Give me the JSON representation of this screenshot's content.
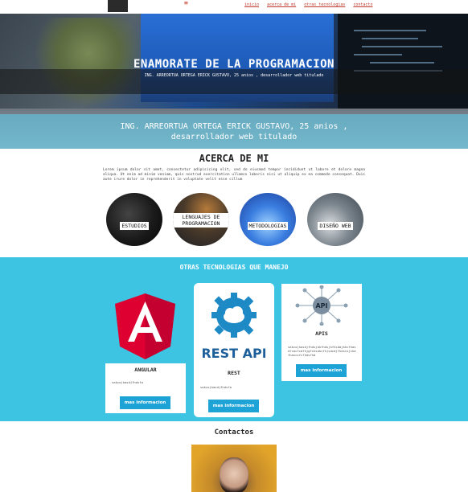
{
  "nav": {
    "links": [
      "inicio",
      "acerca de mi",
      "otras tecnologias",
      "contacto"
    ]
  },
  "hero": {
    "title": "ENAMORATE DE LA PROGRAMACION",
    "subtitle": "ING. ARREORTUA ORTEGA ERICK GUSTAVO, 25 anios , desarrollador web titulado",
    "band_text": "ING. ARREORTUA ORTEGA ERICK GUSTAVO, 25 anios , desarrollador web titulado"
  },
  "about": {
    "title": "ACERCA DE MI",
    "text": "Lorem ipsum dolor sit amet, consectetur adipisicing elit, sed do eiusmod tempor incididunt ut labore et dolore magna aliqua. Ut enim ad minim veniam, quis nostrud exercitation ullamco laboris nisi ut aliquip ex ea commodo consequat. Duis aute irure dolor in reprehenderit in voluptate velit esse cillum",
    "circles": [
      "ESTUDIOS",
      "LENGUAJES DE PROGRAMACION",
      "METODOLOGIAS",
      "DISEÑO WEB"
    ]
  },
  "techs": {
    "title": "OTRAS TECNOLOGIAS QUE MANEJO",
    "cards": [
      {
        "name": "ANGULAR",
        "desc": "sakcojkasdjfhdsfa",
        "button": "mas informacion"
      },
      {
        "name": "REST",
        "desc": "sakcojkasdjfhdsfa",
        "button": "mas informacion"
      },
      {
        "name": "APIS",
        "desc": "sakcojkasdjfhdsjakfhdsjkfhsdajkhcfhasdfcacfcdfhjgfchsakcfhjsdcdjfhdscsjckdfhascsfcfhdsfhd",
        "button": "mas informacion"
      }
    ],
    "rest_logo_text": "REST API",
    "api_logo_text": "API"
  },
  "contact": {
    "title": "Contactos"
  },
  "colors": {
    "accent": "#3ec4e3",
    "button": "#1da3d6",
    "nav_link": "#c0392b",
    "angular_red": "#dd0031"
  }
}
